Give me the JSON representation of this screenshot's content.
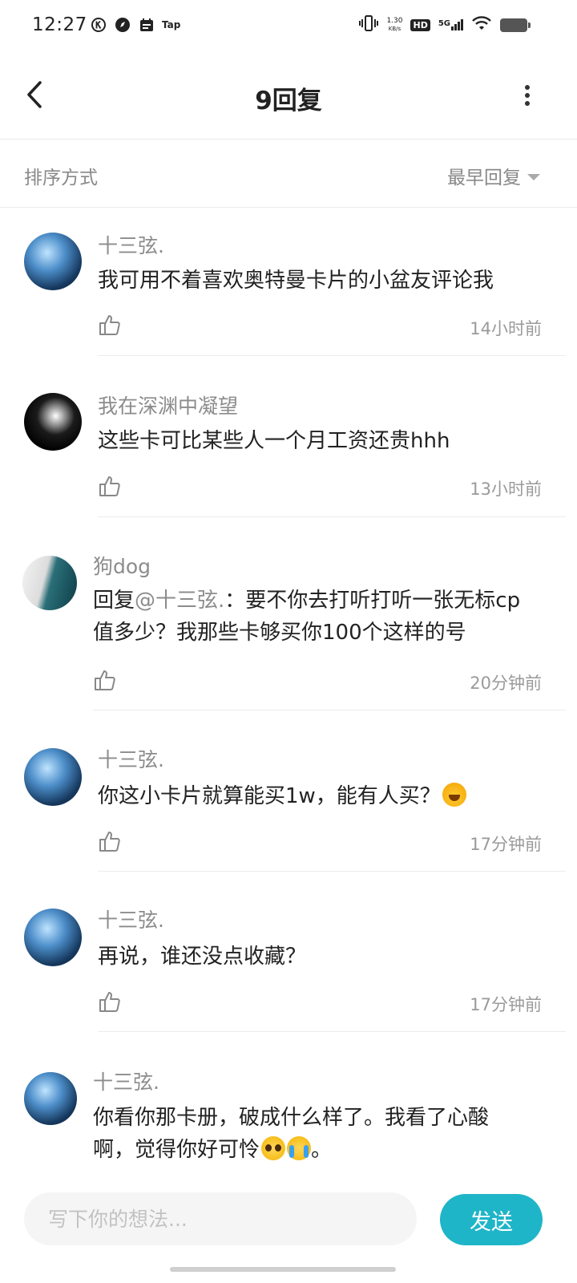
{
  "status_bar": {
    "time": "12:27",
    "tap_label": "Tap",
    "net_speed_value": "1.30",
    "net_speed_unit": "KB/s",
    "hd_label": "HD",
    "network_label": "5G"
  },
  "header": {
    "title": "9回复"
  },
  "sort": {
    "label": "排序方式",
    "selected": "最早回复"
  },
  "replies": [
    {
      "username": "十三弦.",
      "content": "我可用不着喜欢奥特曼卡片的小盆友评论我",
      "time": "14小时前",
      "avatar": "blue-art-avatar"
    },
    {
      "username": "我在深渊中凝望",
      "content": "这些卡可比某些人一个月工资还贵hhh",
      "time": "13小时前",
      "avatar": "dark-figure-avatar"
    },
    {
      "username": "狗dog",
      "reply_prefix": "回复",
      "mention": "@十三弦.",
      "content_line1": "：要不你去打听打听一张无标cp",
      "content_line2": "值多少？我那些卡够买你100个这样的号",
      "time": "20分钟前",
      "avatar": "sea-avatar"
    },
    {
      "username": "十三弦.",
      "content": "你这小卡片就算能买1w，能有人买？",
      "emoji": "laughing-emoji",
      "time": "17分钟前",
      "avatar": "blue-art-avatar"
    },
    {
      "username": "十三弦.",
      "content": "再说，谁还没点收藏？",
      "time": "17分钟前",
      "avatar": "blue-art-avatar"
    },
    {
      "username": "十三弦.",
      "content_line1": "你看你那卡册，破成什么样了。我看了心酸",
      "content_line2": "啊，觉得你好可怜",
      "content_suffix": "。",
      "emojis": [
        "pleading-emoji",
        "crying-emoji"
      ],
      "avatar": "blue-art-avatar"
    }
  ],
  "composer": {
    "placeholder": "写下你的想法...",
    "send_label": "发送"
  },
  "colors": {
    "accent": "#1fb5c8",
    "muted_text": "#8c8c8c"
  }
}
